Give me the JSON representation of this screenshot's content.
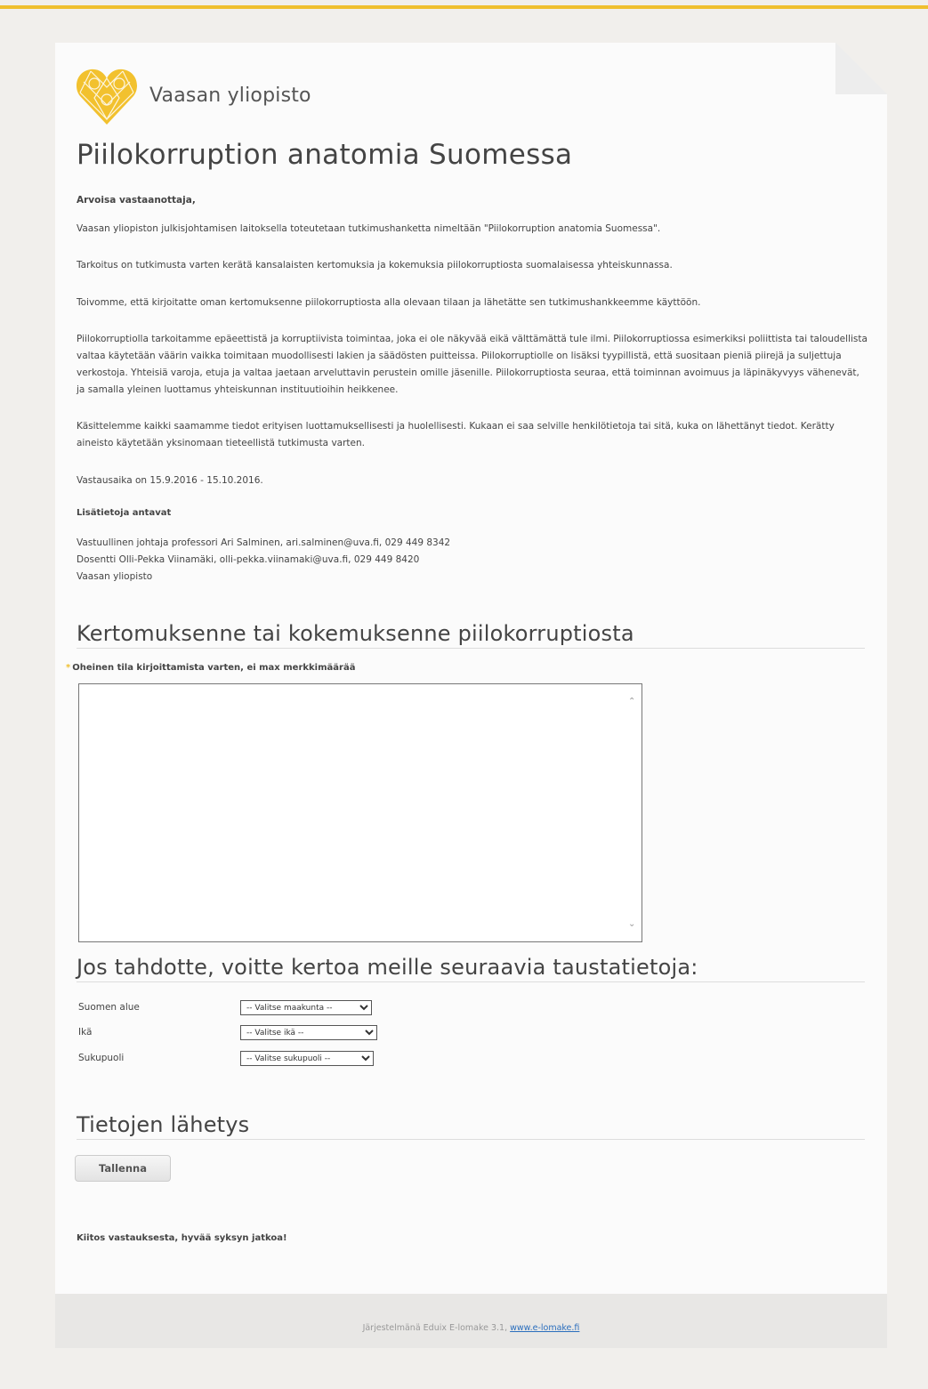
{
  "header": {
    "logo_text": "Vaasan yliopisto",
    "title": "Piilokorruption anatomia Suomessa",
    "accent_color": "#efbf2e"
  },
  "intro": {
    "greeting": "Arvoisa vastaanottaja,",
    "p1": "Vaasan yliopiston julkisjohtamisen laitoksella toteutetaan tutkimushanketta nimeltään \"Piilokorruption anatomia Suomessa\".",
    "p2": "Tarkoitus on tutkimusta varten kerätä kansalaisten kertomuksia ja kokemuksia piilokorruptiosta suomalaisessa yhteiskunnassa.",
    "p3": "Toivomme, että kirjoitatte oman kertomuksenne piilokorruptiosta alla olevaan tilaan ja lähetätte sen tutkimushankkeemme käyttöön.",
    "p4": "Piilokorruptiolla tarkoitamme epäeettistä ja korruptiivista toimintaa, joka ei ole näkyvää eikä välttämättä tule ilmi. Piilokorruptiossa esimerkiksi poliittista tai taloudellista valtaa käytetään väärin vaikka toimitaan muodollisesti lakien ja säädösten puitteissa. Piilokorruptiolle on lisäksi tyypillistä, että suositaan pieniä piirejä ja suljettuja verkostoja. Yhteisiä varoja, etuja ja valtaa jaetaan arveluttavin perustein omille jäsenille. Piilokorruptiosta seuraa, että toiminnan avoimuus ja läpinäkyvyys vähenevät, ja samalla yleinen luottamus yhteiskunnan instituutioihin heikkenee.",
    "p5": "Käsittelemme kaikki saamamme tiedot erityisen luottamuksellisesti ja huolellisesti. Kukaan ei saa selville henkilötietoja tai sitä, kuka on lähettänyt tiedot. Kerätty aineisto käytetään yksinomaan tieteellistä tutkimusta varten.",
    "p6": "Vastausaika on 15.9.2016 - 15.10.2016.",
    "info_heading": "Lisätietoja antavat",
    "contact1": "Vastuullinen johtaja professori Ari Salminen, ari.salminen@uva.fi, 029 449 8342",
    "contact2": "Dosentti Olli-Pekka Viinamäki, olli-pekka.viinamaki@uva.fi, 029 449 8420",
    "contact3": "Vaasan yliopisto"
  },
  "story": {
    "heading": "Kertomuksenne tai kokemuksenne piilokorruptiosta",
    "required_mark": "*",
    "label": "Oheinen tila kirjoittamista varten, ei max merkkimäärää",
    "value": ""
  },
  "background": {
    "heading": "Jos tahdotte, voitte kertoa meille seuraavia taustatietoja:",
    "region_label": "Suomen alue",
    "region_selected": "-- Valitse maakunta --",
    "age_label": "Ikä",
    "age_selected": "-- Valitse ikä --",
    "gender_label": "Sukupuoli",
    "gender_selected": "-- Valitse sukupuoli --"
  },
  "submit": {
    "heading": "Tietojen lähetys",
    "button_label": "Tallenna",
    "thanks": "Kiitos vastauksesta, hyvää syksyn jatkoa!"
  },
  "footer": {
    "text": "Järjestelmänä Eduix E-lomake 3.1, ",
    "link_text": "www.e-lomake.fi"
  }
}
